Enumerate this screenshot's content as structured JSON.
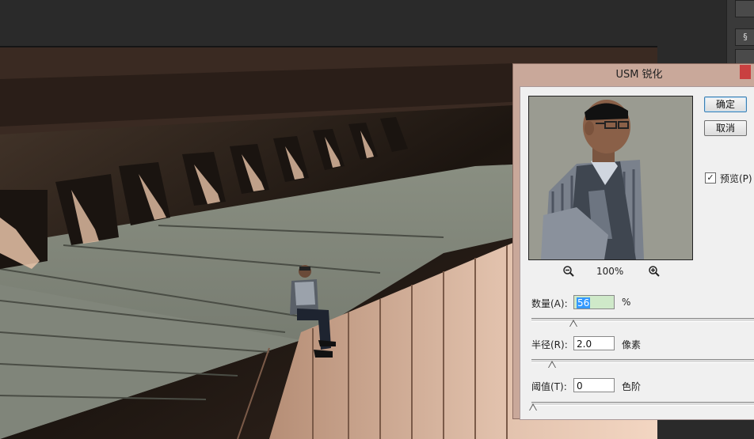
{
  "dialog": {
    "title": "USM 锐化",
    "ok_label": "确定",
    "cancel_label": "取消",
    "preview_label": "预览(P)",
    "preview_checked": true,
    "zoom_level": "100%",
    "amount": {
      "label": "数量(A):",
      "value": "56",
      "unit": "%",
      "slider_fraction": 0.17
    },
    "radius": {
      "label": "半径(R):",
      "value": "2.0",
      "unit": "像素",
      "slider_fraction": 0.08
    },
    "threshold": {
      "label": "阈值(T):",
      "value": "0",
      "unit": "色阶",
      "slider_fraction": 0.0
    }
  },
  "icons": {
    "zoom_out": "zoom-out-icon",
    "zoom_in": "zoom-in-icon",
    "checkbox": "checkbox-checked-icon"
  },
  "colors": {
    "dialog_frame": "#c9a89a",
    "dialog_body": "#f0f0f0",
    "close_button": "#c94040",
    "selection": "#3399ff",
    "workspace": "#2a2a2a"
  }
}
